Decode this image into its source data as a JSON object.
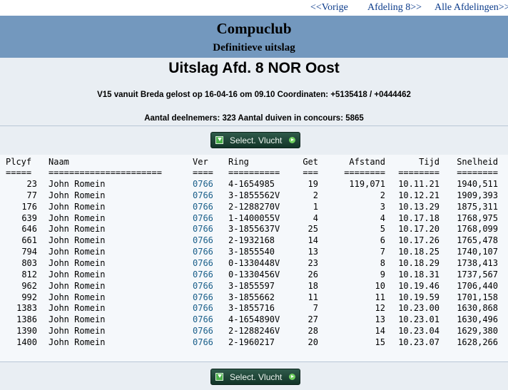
{
  "nav": {
    "prev": "<<Vorige",
    "afdeling": "Afdeling 8>>",
    "alle": "Alle Afdelingen>>"
  },
  "header": {
    "club": "Compuclub",
    "subtitle": "Definitieve uitslag"
  },
  "title": "Uitslag Afd. 8 NOR Oost",
  "info": {
    "line1": "V15 vanuit Breda gelost op 16-04-16 om 09.10 Coordinaten: +5135418 / +0444462",
    "line2": "Aantal deelnemers: 323 Aantal duiven in concours: 5865"
  },
  "button_label": "Select. Vlucht",
  "table": {
    "headers": {
      "plcyf": "Plcyf",
      "naam": "Naam",
      "ver": "Ver",
      "ring": "Ring",
      "get": "Get",
      "afstand": "Afstand",
      "tijd": "Tijd",
      "snelheid": "Snelheid"
    },
    "seps": {
      "plcyf": "=====",
      "naam": "======================",
      "ver": "====",
      "ring": "==========",
      "get": "===",
      "afstand": "========",
      "tijd": "========",
      "snelheid": "========"
    },
    "rows": [
      {
        "plcyf": "23",
        "naam": "John Romein",
        "ver": "0766",
        "ring": "4-1654985",
        "get": "19",
        "afstand": "119,071",
        "tijd": "10.11.21",
        "snelheid": "1940,511"
      },
      {
        "plcyf": "77",
        "naam": "John Romein",
        "ver": "0766",
        "ring": "3-1855562V",
        "get": "2",
        "afstand": "2",
        "tijd": "10.12.21",
        "snelheid": "1909,393"
      },
      {
        "plcyf": "176",
        "naam": "John Romein",
        "ver": "0766",
        "ring": "2-1288270V",
        "get": "1",
        "afstand": "3",
        "tijd": "10.13.29",
        "snelheid": "1875,311"
      },
      {
        "plcyf": "639",
        "naam": "John Romein",
        "ver": "0766",
        "ring": "1-1400055V",
        "get": "4",
        "afstand": "4",
        "tijd": "10.17.18",
        "snelheid": "1768,975"
      },
      {
        "plcyf": "646",
        "naam": "John Romein",
        "ver": "0766",
        "ring": "3-1855637V",
        "get": "25",
        "afstand": "5",
        "tijd": "10.17.20",
        "snelheid": "1768,099"
      },
      {
        "plcyf": "661",
        "naam": "John Romein",
        "ver": "0766",
        "ring": "2-1932168",
        "get": "14",
        "afstand": "6",
        "tijd": "10.17.26",
        "snelheid": "1765,478"
      },
      {
        "plcyf": "794",
        "naam": "John Romein",
        "ver": "0766",
        "ring": "3-1855540",
        "get": "13",
        "afstand": "7",
        "tijd": "10.18.25",
        "snelheid": "1740,107"
      },
      {
        "plcyf": "803",
        "naam": "John Romein",
        "ver": "0766",
        "ring": "0-1330448V",
        "get": "23",
        "afstand": "8",
        "tijd": "10.18.29",
        "snelheid": "1738,413"
      },
      {
        "plcyf": "812",
        "naam": "John Romein",
        "ver": "0766",
        "ring": "0-1330456V",
        "get": "26",
        "afstand": "9",
        "tijd": "10.18.31",
        "snelheid": "1737,567"
      },
      {
        "plcyf": "962",
        "naam": "John Romein",
        "ver": "0766",
        "ring": "3-1855597",
        "get": "18",
        "afstand": "10",
        "tijd": "10.19.46",
        "snelheid": "1706,440"
      },
      {
        "plcyf": "992",
        "naam": "John Romein",
        "ver": "0766",
        "ring": "3-1855662",
        "get": "11",
        "afstand": "11",
        "tijd": "10.19.59",
        "snelheid": "1701,158"
      },
      {
        "plcyf": "1383",
        "naam": "John Romein",
        "ver": "0766",
        "ring": "3-1855716",
        "get": "7",
        "afstand": "12",
        "tijd": "10.23.00",
        "snelheid": "1630,868"
      },
      {
        "plcyf": "1386",
        "naam": "John Romein",
        "ver": "0766",
        "ring": "4-1654890V",
        "get": "27",
        "afstand": "13",
        "tijd": "10.23.01",
        "snelheid": "1630,496"
      },
      {
        "plcyf": "1390",
        "naam": "John Romein",
        "ver": "0766",
        "ring": "2-1288246V",
        "get": "28",
        "afstand": "14",
        "tijd": "10.23.04",
        "snelheid": "1629,380"
      },
      {
        "plcyf": "1400",
        "naam": "John Romein",
        "ver": "0766",
        "ring": "2-1960217",
        "get": "20",
        "afstand": "15",
        "tijd": "10.23.07",
        "snelheid": "1628,266"
      }
    ]
  }
}
